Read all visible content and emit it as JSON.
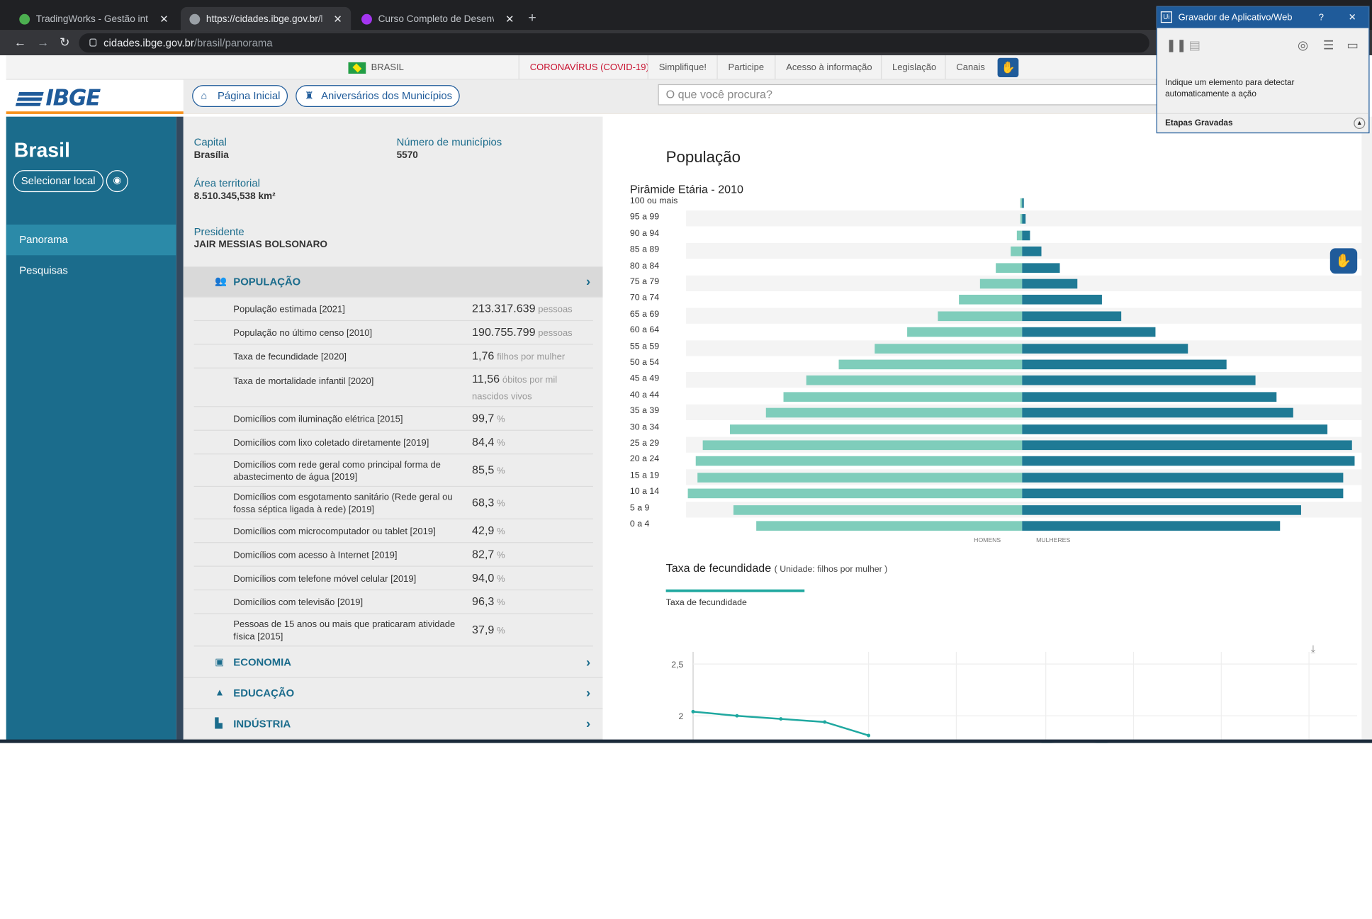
{
  "browser": {
    "tabs": [
      {
        "title": "TradingWorks - Gestão inteligente",
        "active": false,
        "favicon_color": "#4caf50"
      },
      {
        "title": "https://cidades.ibge.gov.br/brasil",
        "active": true,
        "favicon_color": "#9aa0a6"
      },
      {
        "title": "Curso Completo de Desenvolvedor",
        "active": false,
        "favicon_color": "#a435f0"
      }
    ],
    "url_host": "cidades.ibge.gov.br",
    "url_path": "/brasil/panorama"
  },
  "govbar": {
    "country": "BRASIL",
    "links": [
      "CORONAVÍRUS (COVID-19)",
      "Simplifique!",
      "Participe",
      "Acesso à informação",
      "Legislação",
      "Canais"
    ]
  },
  "header": {
    "logo": "IBGE",
    "home_label": "Página Inicial",
    "anniv_label": "Aniversários dos Municípios",
    "search_placeholder": "O que você procura?"
  },
  "sidebar": {
    "title": "Brasil",
    "select_label": "Selecionar local",
    "items": [
      "Panorama",
      "Pesquisas"
    ]
  },
  "summary": {
    "capital_label": "Capital",
    "capital": "Brasília",
    "municipios_label": "Número de municípios",
    "municipios": "5570",
    "area_label": "Área territorial",
    "area": "8.510.345,538 km²",
    "presidente_label": "Presidente",
    "presidente": "JAIR MESSIAS BOLSONARO"
  },
  "categories": [
    "POPULAÇÃO",
    "ECONOMIA",
    "EDUCAÇÃO",
    "INDÚSTRIA"
  ],
  "indicators": [
    {
      "label": "População estimada [2021]",
      "value": "213.317.639",
      "unit": "pessoas"
    },
    {
      "label": "População no último censo [2010]",
      "value": "190.755.799",
      "unit": "pessoas"
    },
    {
      "label": "Taxa de fecundidade [2020]",
      "value": "1,76",
      "unit": "filhos por mulher"
    },
    {
      "label": "Taxa de mortalidade infantil [2020]",
      "value": "11,56",
      "unit": "óbitos por mil nascidos vivos"
    },
    {
      "label": "Domicílios com iluminação elétrica [2015]",
      "value": "99,7",
      "unit": "%"
    },
    {
      "label": "Domicílios com lixo coletado diretamente [2019]",
      "value": "84,4",
      "unit": "%"
    },
    {
      "label": "Domicílios com rede geral como principal forma de abastecimento de água [2019]",
      "value": "85,5",
      "unit": "%"
    },
    {
      "label": "Domicílios com esgotamento sanitário (Rede geral ou fossa séptica ligada à rede) [2019]",
      "value": "68,3",
      "unit": "%"
    },
    {
      "label": "Domicílios com microcomputador ou tablet [2019]",
      "value": "42,9",
      "unit": "%"
    },
    {
      "label": "Domicílios com acesso à Internet [2019]",
      "value": "82,7",
      "unit": "%"
    },
    {
      "label": "Domicílios com telefone móvel celular [2019]",
      "value": "94,0",
      "unit": "%"
    },
    {
      "label": "Domicílios com televisão [2019]",
      "value": "96,3",
      "unit": "%"
    },
    {
      "label": "Pessoas de 15 anos ou mais que praticaram atividade física [2015]",
      "value": "37,9",
      "unit": "%"
    }
  ],
  "right": {
    "section_title": "População",
    "fec_title": "Taxa de fecundidade",
    "fec_unit": "( Unidade: filhos por mulher )",
    "fec_series": "Taxa de fecundidade"
  },
  "chart_data": [
    {
      "type": "bar",
      "title": "Pirâmide Etária - 2010",
      "categories": [
        "100 ou mais",
        "95 a 99",
        "90 a 94",
        "85 a 89",
        "80 a 84",
        "75 a 79",
        "70 a 74",
        "65 a 69",
        "60 a 64",
        "55 a 59",
        "50 a 54",
        "45 a 49",
        "40 a 44",
        "35 a 39",
        "30 a 34",
        "25 a 29",
        "20 a 24",
        "15 a 19",
        "10 a 14",
        "5 a 9",
        "0 a 4"
      ],
      "series": [
        {
          "name": "HOMENS",
          "color": "#7fcdbb",
          "values": [
            0.1,
            0.1,
            0.3,
            0.7,
            1.6,
            2.6,
            3.9,
            5.2,
            7.1,
            9.1,
            11.3,
            13.3,
            14.7,
            15.8,
            18.0,
            19.7,
            20.1,
            20.0,
            20.6,
            17.8,
            16.4
          ]
        },
        {
          "name": "MULHERES",
          "color": "#1f7a95",
          "values": [
            0.1,
            0.2,
            0.5,
            1.2,
            2.3,
            3.4,
            4.9,
            6.1,
            8.2,
            10.2,
            12.6,
            14.4,
            15.7,
            16.7,
            18.8,
            20.3,
            20.5,
            19.8,
            19.8,
            17.2,
            15.9
          ]
        }
      ]
    },
    {
      "type": "line",
      "title": "Taxa de fecundidade",
      "ylabel": "filhos por mulher",
      "yticks": [
        "2,5",
        "2"
      ],
      "ylim": [
        1.5,
        2.5
      ],
      "series": [
        {
          "name": "Taxa de fecundidade",
          "color": "#1fa8a0",
          "values": [
            2.04,
            2.0,
            1.97,
            1.94,
            1.81
          ]
        }
      ]
    }
  ],
  "recorder": {
    "title": "Gravador de Aplicativo/Web",
    "message": "Indique um elemento para detectar automaticamente a ação",
    "footer": "Etapas Gravadas"
  }
}
